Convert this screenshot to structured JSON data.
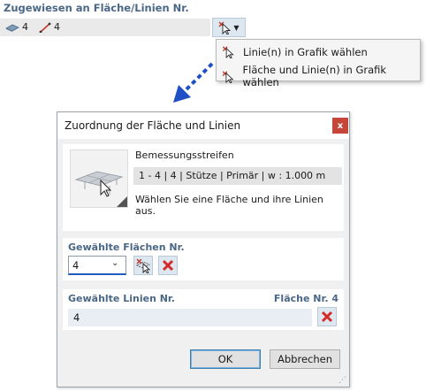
{
  "property": {
    "title": "Zugewiesen an Fläche/Linien Nr.",
    "surface_value": "4",
    "line_value": "4"
  },
  "pick_menu": {
    "items": [
      {
        "label": "Linie(n) in Grafik wählen"
      },
      {
        "label": "Fläche und Linie(n) in Grafik wählen"
      }
    ]
  },
  "dialog": {
    "title": "Zuordnung der Fläche und Linien",
    "close_label": "x",
    "strip": {
      "name": "Bemessungsstreifen",
      "info": "1 - 4 | 4 | Stütze | Primär | w : 1.000 m",
      "message": "Wählen Sie eine Fläche und ihre Linien aus."
    },
    "surfaces": {
      "label": "Gewählte Flächen Nr.",
      "value": "4"
    },
    "lines": {
      "label": "Gewählte Linien Nr.",
      "surface_ref": "Fläche Nr. 4",
      "value": "4"
    },
    "buttons": {
      "ok": "OK",
      "cancel": "Abbrechen"
    }
  },
  "colors": {
    "section_label": "#4a6786",
    "close_button": "#c4473a",
    "delete_x": "#d42a2a",
    "arrow": "#1f4fc4"
  }
}
